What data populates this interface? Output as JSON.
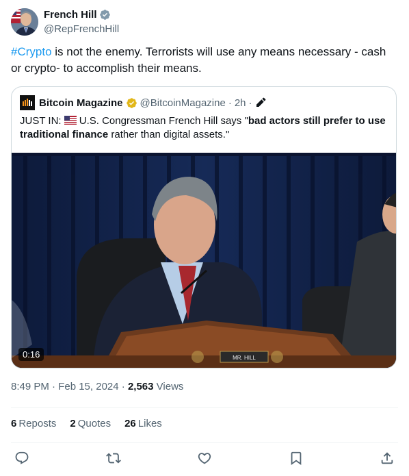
{
  "author": {
    "name": "French Hill",
    "handle": "@RepFrenchHill"
  },
  "tweet": {
    "hashtag": "#Crypto",
    "text": " is not the enemy. Terrorists will use any means necessary - cash or crypto- to accomplish their means."
  },
  "quoted": {
    "name": "Bitcoin Magazine",
    "handle": "@BitcoinMagazine",
    "dot": "·",
    "time": "2h",
    "dot2": "·",
    "text_prefix": "JUST IN: ",
    "text_middle": "U.S. Congressman French Hill says \"",
    "text_bold": "bad actors still prefer to use traditional finance",
    "text_suffix": " rather than digital assets.\"",
    "video": {
      "duration": "0:16",
      "nameplate": "MR. HILL"
    }
  },
  "meta": {
    "timestamp": "8:49 PM · Feb 15, 2024",
    "sep": " · ",
    "views_count": "2,563",
    "views_label": " Views"
  },
  "stats": {
    "reposts_count": "6",
    "reposts_label": "Reposts",
    "quotes_count": "2",
    "quotes_label": "Quotes",
    "likes_count": "26",
    "likes_label": "Likes"
  },
  "colors": {
    "accent": "#1d9bf0",
    "secondary_text": "#536471",
    "border": "#cfd9de"
  }
}
